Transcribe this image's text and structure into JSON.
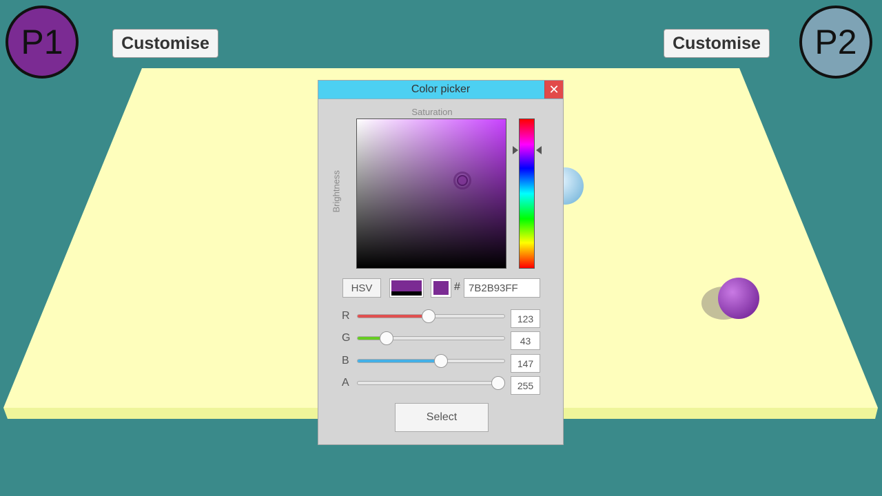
{
  "players": {
    "p1": {
      "label": "P1",
      "color": "#7b2b93"
    },
    "p2": {
      "label": "P2",
      "color": "#7ea3b5"
    }
  },
  "customise": {
    "left_label": "Customise",
    "right_label": "Customise"
  },
  "picker": {
    "title": "Color picker",
    "close_icon": "close-icon",
    "saturation_label": "Saturation",
    "brightness_label": "Brightness",
    "hue_color": "#c842ff",
    "mode_label": "HSV",
    "hash_symbol": "#",
    "hex_value": "7B2B93FF",
    "current_color": "#7b2b93",
    "previous_color": "#000000",
    "channels": [
      {
        "label": "R",
        "value": "123",
        "fraction": 0.4824,
        "color": "#e05050"
      },
      {
        "label": "G",
        "value": "43",
        "fraction": 0.1686,
        "color": "#66cc22"
      },
      {
        "label": "B",
        "value": "147",
        "fraction": 0.5765,
        "color": "#44b0e6"
      },
      {
        "label": "A",
        "value": "255",
        "fraction": 1.0,
        "color": "#bbbbbb"
      }
    ],
    "select_label": "Select"
  }
}
